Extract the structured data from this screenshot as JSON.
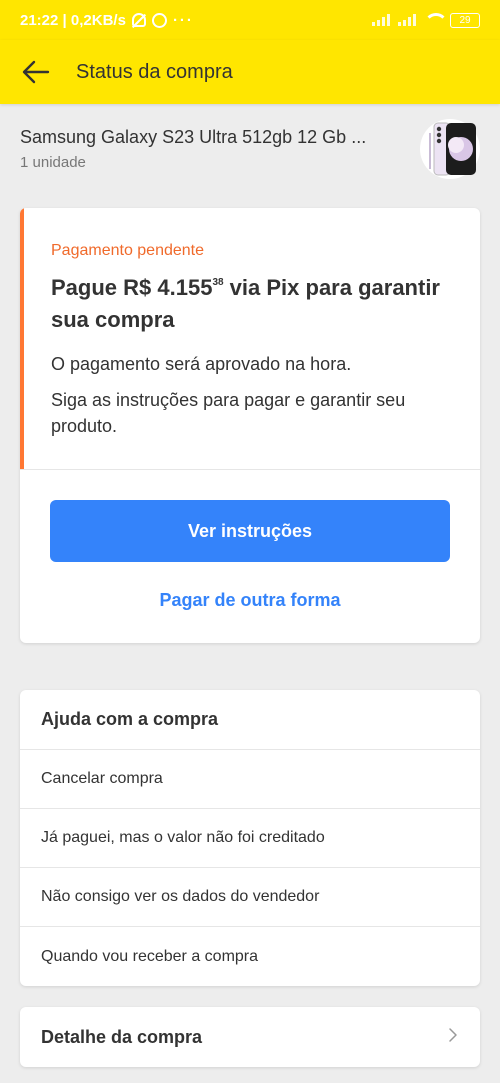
{
  "status_bar": {
    "time_speed": "21:22 | 0,2KB/s",
    "more": "···",
    "battery": "29"
  },
  "app_bar": {
    "title": "Status da compra"
  },
  "product": {
    "name": "Samsung Galaxy S23 Ultra 512gb 12 Gb ...",
    "quantity": "1 unidade"
  },
  "payment": {
    "status": "Pagamento pendente",
    "headline_prefix": "Pague R$ 4.155",
    "headline_cents": "38",
    "headline_suffix": " via Pix para garantir sua compra",
    "approval_text": "O pagamento será aprovado na hora.",
    "instructions_text": "Siga as instruções para pagar e garantir seu produto.",
    "primary_button": "Ver instruções",
    "secondary_link": "Pagar de outra forma"
  },
  "help": {
    "title": "Ajuda com a compra",
    "items": [
      "Cancelar compra",
      "Já paguei, mas o valor não foi creditado",
      "Não consigo ver os dados do vendedor",
      "Quando vou receber a compra"
    ]
  },
  "detail": {
    "label": "Detalhe da compra"
  },
  "colors": {
    "brand_yellow": "#ffe600",
    "primary_blue": "#3483fa",
    "pending_orange": "#f06a2b"
  }
}
